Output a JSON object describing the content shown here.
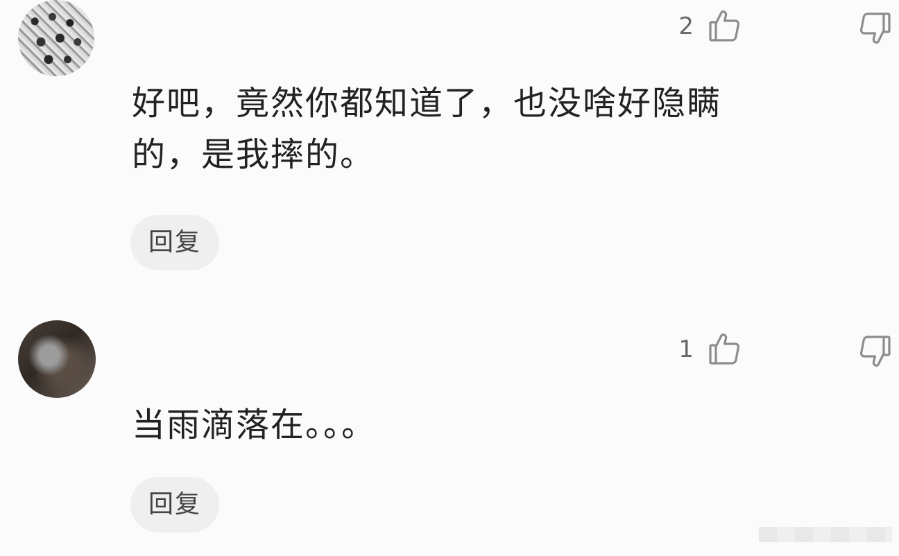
{
  "comments": [
    {
      "avatar_icon": "group-photo-avatar",
      "likes": "2",
      "text_lines": [
        "好吧，竟然你都知道了，也没啥好隐瞒",
        "的，是我摔的。"
      ],
      "reply_label": "回复"
    },
    {
      "avatar_icon": "portrait-avatar",
      "likes": "1",
      "text_lines": [
        "当雨滴落在。。。"
      ],
      "reply_label": "回复"
    }
  ],
  "icons": {
    "like": "thumbs-up-icon",
    "dislike": "thumbs-down-icon"
  },
  "colors": {
    "background": "#fbfbfb",
    "text": "#222222",
    "muted": "#666666",
    "reply_bg": "#efefef"
  }
}
